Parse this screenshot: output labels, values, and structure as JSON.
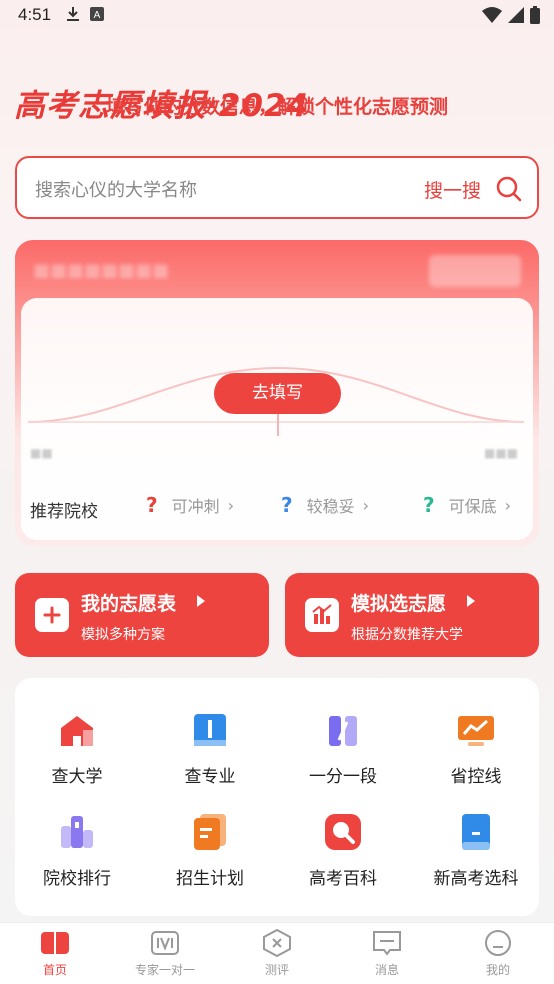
{
  "status_bar": {
    "time": "4:51",
    "icons_left": [
      "download-icon",
      "app-a-icon"
    ],
    "icons_right": [
      "wifi-icon",
      "signal-icon",
      "battery-icon"
    ]
  },
  "header": {
    "title": "高考志愿填报·2024"
  },
  "search": {
    "placeholder": "搜索心仪的大学名称",
    "button_label": "搜一搜"
  },
  "prediction": {
    "message": "填写你的分数信息，解锁个性化志愿预测",
    "button_label": "去填写",
    "recommend_label": "推荐院校",
    "items": [
      {
        "label": "可冲刺",
        "color": "#e8403c"
      },
      {
        "label": "较稳妥",
        "color": "#3a86e8"
      },
      {
        "label": "可保底",
        "color": "#2bb894"
      }
    ]
  },
  "big_cards": [
    {
      "title": "我的志愿表",
      "subtitle": "模拟多种方案",
      "icon": "plus-doc-icon"
    },
    {
      "title": "模拟选志愿",
      "subtitle": "根据分数推荐大学",
      "icon": "chart-bars-icon"
    }
  ],
  "tools": [
    {
      "label": "查大学",
      "icon": "school-icon",
      "color": "#ee4440"
    },
    {
      "label": "查专业",
      "icon": "book-icon",
      "color": "#2f8ae8"
    },
    {
      "label": "一分一段",
      "icon": "segments-icon",
      "color": "#7a6cf0"
    },
    {
      "label": "省控线",
      "icon": "trend-board-icon",
      "color": "#f07a22"
    },
    {
      "label": "院校排行",
      "icon": "ranking-icon",
      "color": "#8a78f0"
    },
    {
      "label": "招生计划",
      "icon": "plan-doc-icon",
      "color": "#f07a22"
    },
    {
      "label": "高考百科",
      "icon": "magnifier-icon",
      "color": "#ee4440"
    },
    {
      "label": "新高考选科",
      "icon": "bookmark-book-icon",
      "color": "#2f8ae8"
    }
  ],
  "nav": {
    "active_index": 0,
    "items": [
      {
        "label": "首页",
        "icon": "home-book-icon"
      },
      {
        "label": "专家一对一",
        "icon": "expert-icon"
      },
      {
        "label": "测评",
        "icon": "test-icon"
      },
      {
        "label": "消息",
        "icon": "message-icon"
      },
      {
        "label": "我的",
        "icon": "profile-icon"
      }
    ]
  },
  "colors": {
    "accent": "#ee4440",
    "accent_dark": "#e8403c"
  }
}
